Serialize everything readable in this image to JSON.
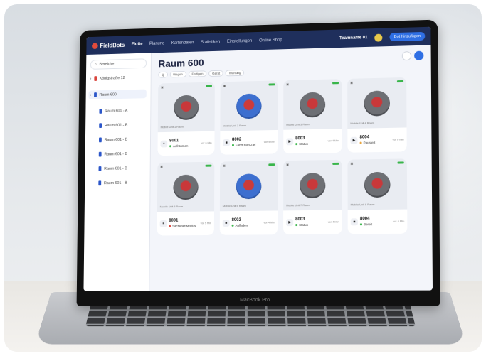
{
  "app": {
    "brand": "FieldBots",
    "nav": [
      "Flotte",
      "Planung",
      "Kartendaten",
      "Statistiken",
      "Einstellungen",
      "Online Shop"
    ],
    "team": "Teamname 01",
    "new_button": "Bot hinzufügen"
  },
  "sidebar": {
    "button": "Bereiche",
    "items": [
      {
        "label": "Königstraße 12",
        "color": "#d9443c"
      },
      {
        "label": "Raum 600",
        "color": "#2b56c9"
      },
      {
        "label": "Raum 601 - A",
        "color": "#2b56c9"
      },
      {
        "label": "Raum 601 - B",
        "color": "#2b56c9"
      },
      {
        "label": "Raum 601 - B",
        "color": "#2b56c9"
      },
      {
        "label": "Raum 601 - B",
        "color": "#2b56c9"
      },
      {
        "label": "Raum 601 - B",
        "color": "#2b56c9"
      },
      {
        "label": "Raum 601 - B",
        "color": "#2b56c9"
      }
    ]
  },
  "main": {
    "title": "Raum 600",
    "filters": [
      "Q",
      "Wagen",
      "Fertigen",
      "Gerät",
      "Wartung"
    ]
  },
  "cards": [
    {
      "id": "8001",
      "status": "Aufräumen",
      "loc": "Mobile Unit 1 Raum",
      "color": "#2b56c9",
      "robot": "grey",
      "play": "⏸",
      "dot": "#39b54a",
      "time": "vor 6 Min"
    },
    {
      "id": "8002",
      "status": "Fahrt zum Ziel",
      "loc": "Mobile Unit 2 Raum",
      "color": "#2b56c9",
      "robot": "blue",
      "play": "■",
      "dot": "#39b54a",
      "time": "vor 4 Min"
    },
    {
      "id": "8003",
      "status": "Status",
      "loc": "Mobile Unit 3 Raum",
      "color": "#2b56c9",
      "robot": "grey",
      "play": "▶",
      "dot": "#39b54a",
      "time": "vor 4 Min"
    },
    {
      "id": "8004",
      "status": "Pausiert",
      "loc": "Mobile Unit 4 Raum",
      "color": "#2b56c9",
      "robot": "grey",
      "play": "▶",
      "dot": "#e8a33a",
      "time": "vor 6 Min"
    },
    {
      "id": "8001",
      "status": "Sachkraft Modus",
      "loc": "Mobile Unit 5 Raum",
      "color": "#2b56c9",
      "robot": "grey",
      "play": "⏸",
      "dot": "#d9443c",
      "time": "vor 5 Min"
    },
    {
      "id": "8002",
      "status": "Aufladen",
      "loc": "Mobile Unit 6 Raum",
      "color": "#2b56c9",
      "robot": "blue",
      "play": "■",
      "dot": "#39b54a",
      "time": "vor 4 Min"
    },
    {
      "id": "8003",
      "status": "Status",
      "loc": "Mobile Unit 7 Raum",
      "color": "#2b56c9",
      "robot": "grey",
      "play": "▶",
      "dot": "#39b54a",
      "time": "vor 4 Min"
    },
    {
      "id": "8004",
      "status": "Bereit",
      "loc": "Mobile Unit 8 Raum",
      "color": "#2b56c9",
      "robot": "grey",
      "play": "■",
      "dot": "#39b54a",
      "time": "vor 6 Min"
    }
  ],
  "laptop_label": "MacBook Pro"
}
